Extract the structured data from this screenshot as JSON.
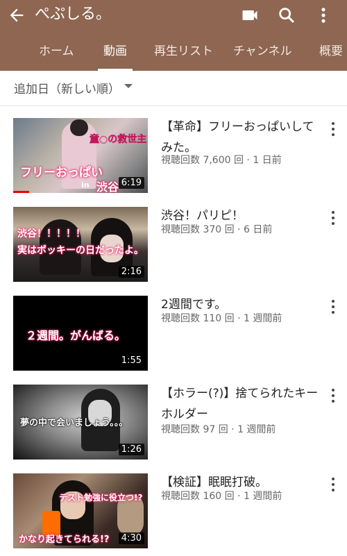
{
  "appbar": {
    "title": "ぺぷしる。",
    "icons": [
      "back-arrow-icon",
      "video-camera-icon",
      "search-icon",
      "more-vert-icon"
    ]
  },
  "tabs": [
    {
      "label": "ホーム",
      "active": false
    },
    {
      "label": "動画",
      "active": true
    },
    {
      "label": "再生リスト",
      "active": false
    },
    {
      "label": "チャンネル",
      "active": false
    },
    {
      "label": "概要",
      "active": false
    }
  ],
  "sort": {
    "label": "追加日（新しい順）"
  },
  "videos": [
    {
      "title": "【革命】フリーおっぱいしてみた。",
      "meta": "視聴回数 7,600 回 · 1 日前",
      "duration": "6:19",
      "thumb_text": [
        "童○の救世主",
        "フリーおっぱい",
        "in",
        "渋谷"
      ],
      "watched_fraction": 0.12
    },
    {
      "title": "渋谷！パリピ！",
      "meta": "視聴回数 370 回 · 6 日前",
      "duration": "2:16",
      "thumb_text": [
        "渋谷！！！！！",
        "実はポッキーの日だったよ。"
      ]
    },
    {
      "title": "2週間です。",
      "meta": "視聴回数 110 回 · 1 週間前",
      "duration": "1:55",
      "thumb_text": [
        "２週間。がんばる。"
      ]
    },
    {
      "title": "【ホラー(?)】捨てられたキーホルダー",
      "meta": "視聴回数 97 回 · 1 週間前",
      "duration": "1:26",
      "thumb_text": [
        "夢の中で会いましょう。。。"
      ]
    },
    {
      "title": "【検証】眠眠打破。",
      "meta": "視聴回数 160 回 · 1 週間前",
      "duration": "4:30",
      "thumb_text": [
        "テスト勉強に役立つ!?",
        "かなり起きてられる!?"
      ]
    }
  ]
}
